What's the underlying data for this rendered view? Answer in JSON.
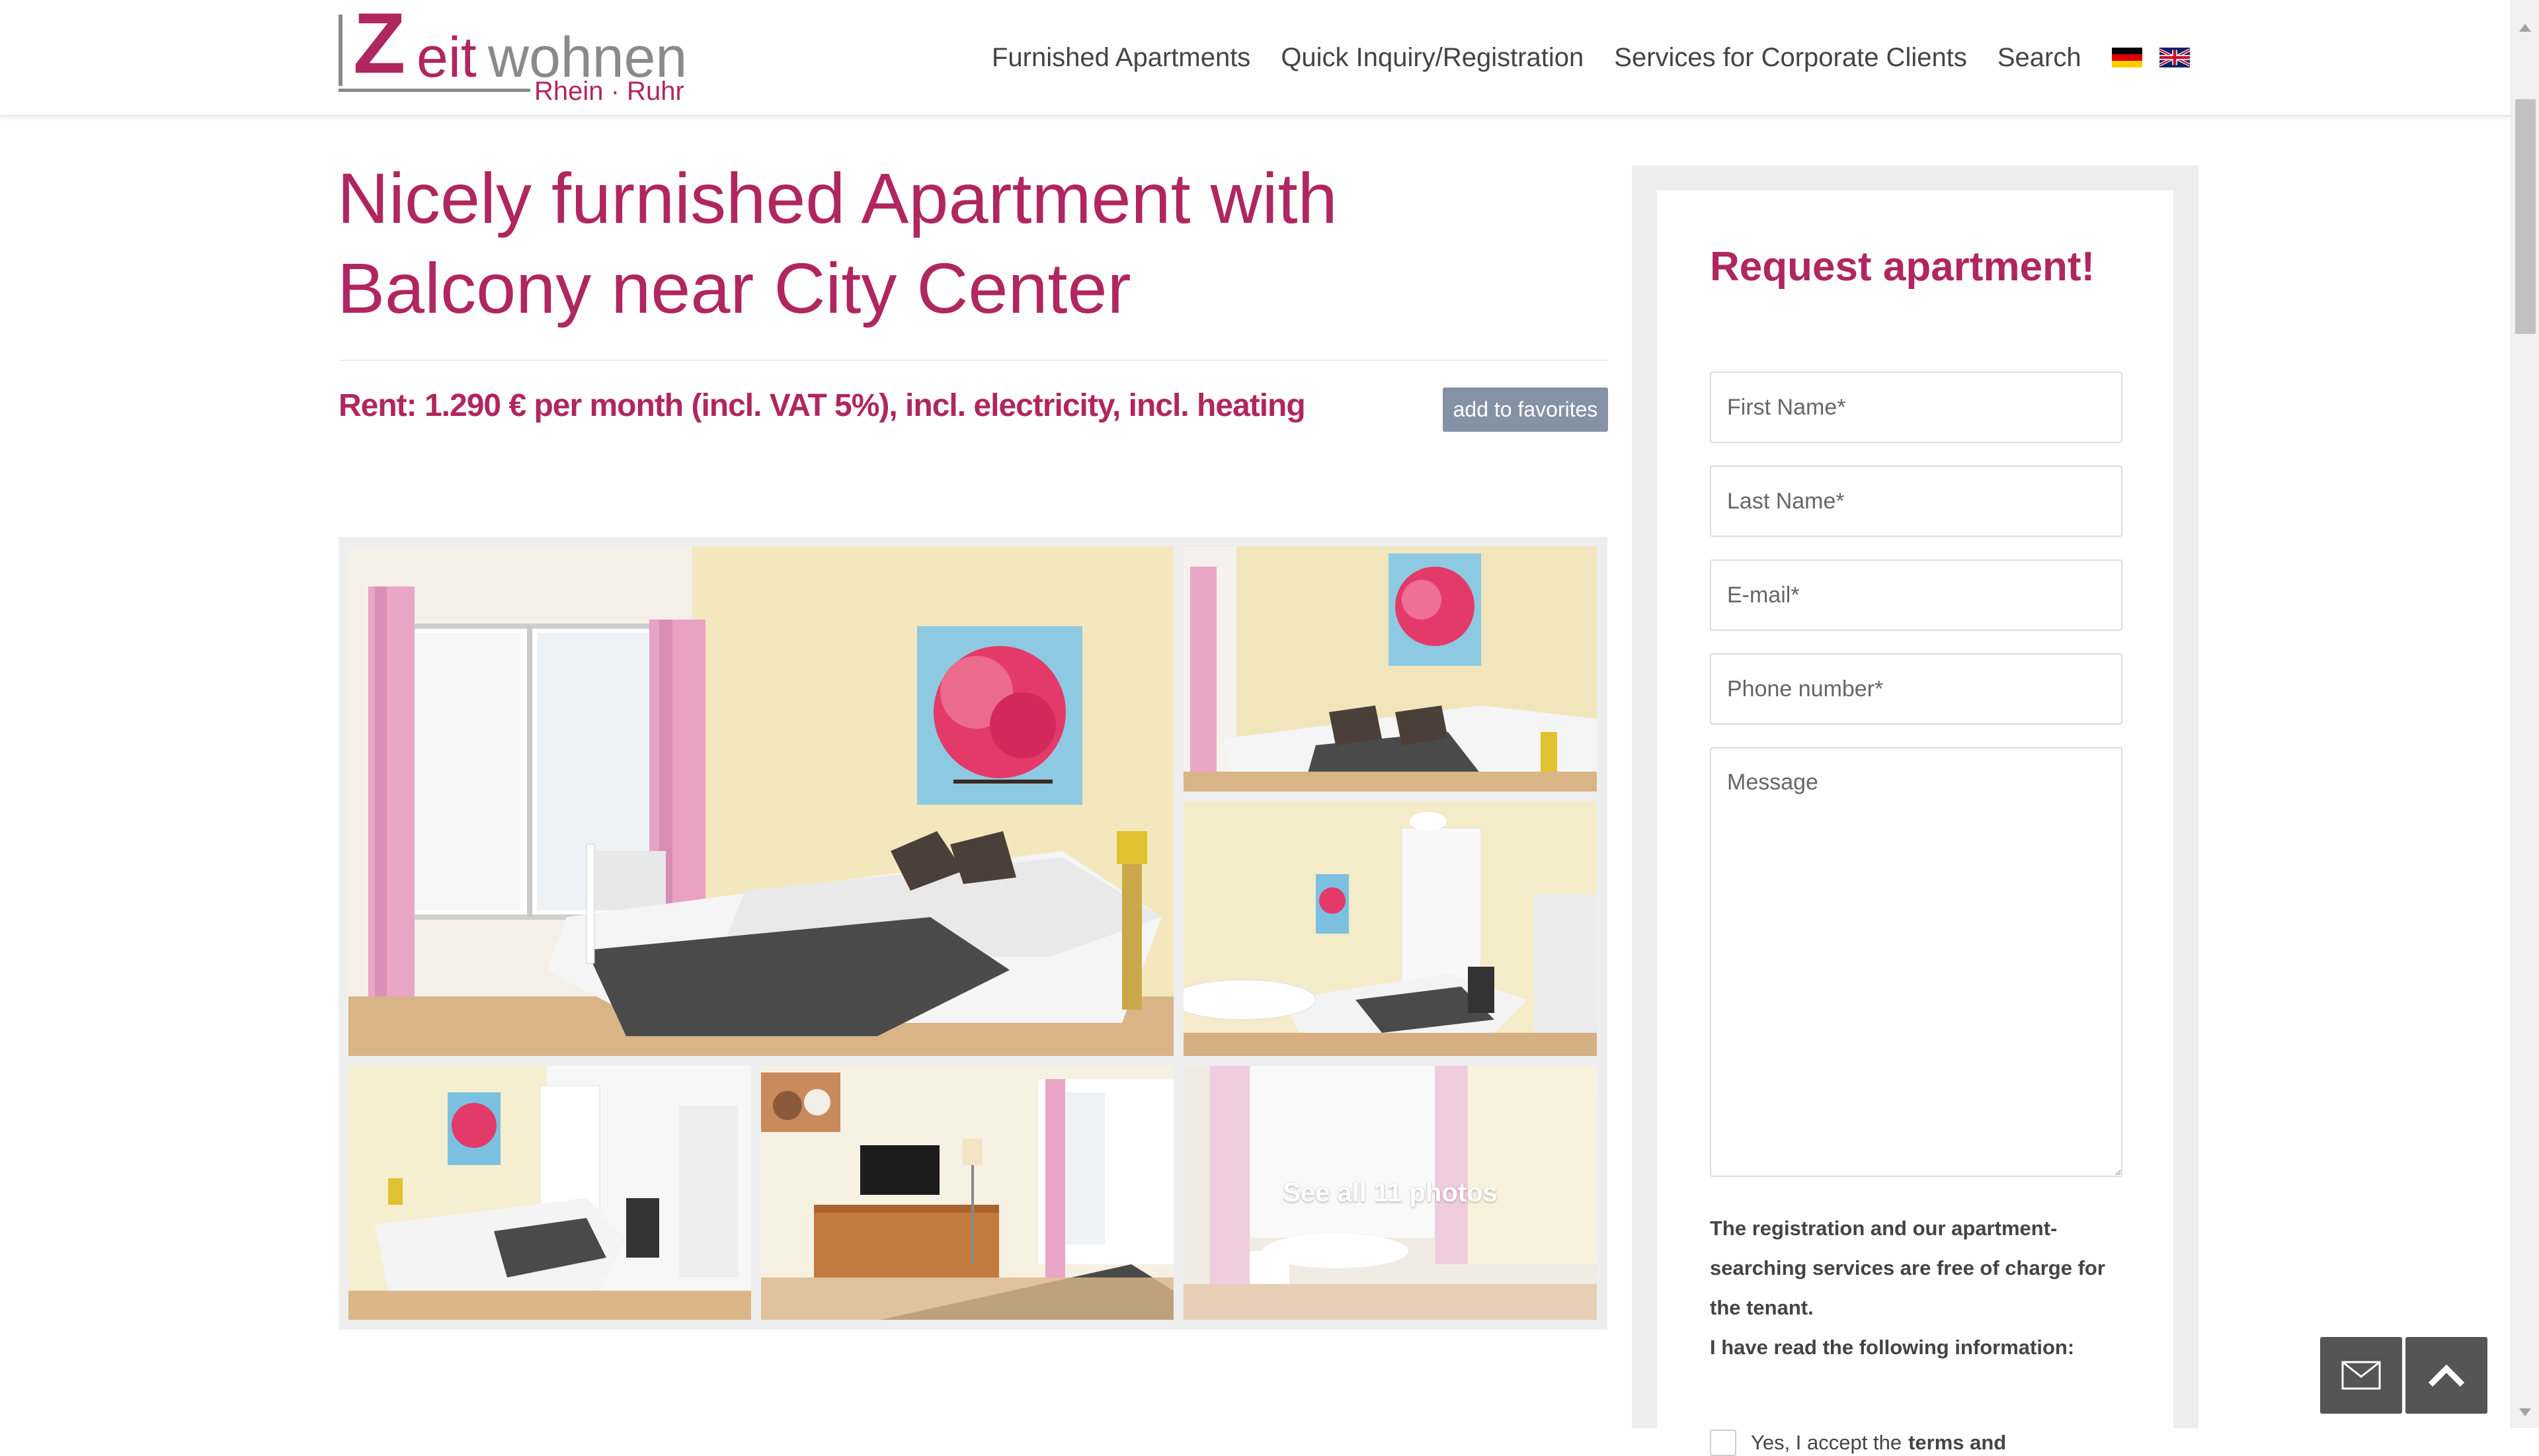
{
  "header": {
    "logo": {
      "letter": "Z",
      "part1": "eit",
      "part2": "wohnen",
      "subtitle": "Rhein · Ruhr"
    },
    "nav": [
      "Furnished Apartments",
      "Quick Inquiry/Registration",
      "Services for Corporate Clients",
      "Search"
    ],
    "flags": [
      "flag-de-icon",
      "flag-gb-icon"
    ]
  },
  "listing": {
    "title": "Nicely furnished Apartment with Balcony near City Center",
    "rent": "Rent: 1.290 € per month (incl. VAT 5%), incl. electricity, incl. heating",
    "favorites_label": "add to favorites"
  },
  "gallery": {
    "see_all": "See all 11 photos"
  },
  "form": {
    "title": "Request apartment!",
    "fields": {
      "first_name": "First Name*",
      "last_name": "Last Name*",
      "email": "E-mail*",
      "phone": "Phone number*",
      "message": "Message"
    },
    "info_line1": "The registration and our apartment-searching services are free of charge for the tenant.",
    "info_line2": "I have read the following information:",
    "checkbox_label": "Yes, I accept the",
    "checkbox_link": "terms and"
  },
  "floating": {
    "contact_icon": "mail-icon",
    "top_icon": "chevron-up-icon"
  },
  "colors": {
    "brand": "#b0265f",
    "grey": "#8a8a8a",
    "fav_button": "#8592a6",
    "float_button": "#555555"
  }
}
